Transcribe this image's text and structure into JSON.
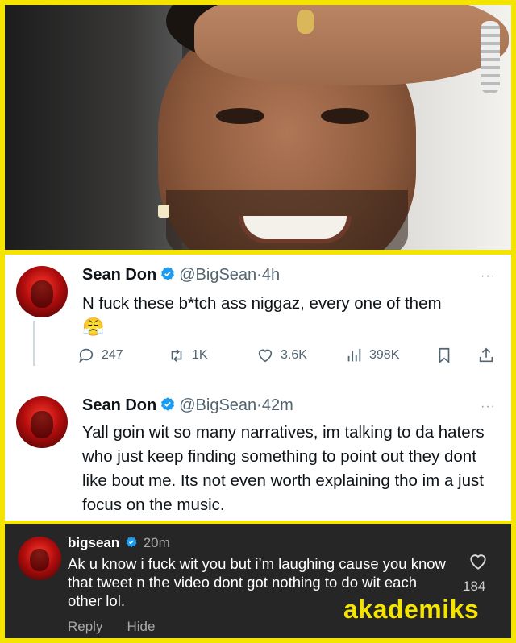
{
  "tweets": [
    {
      "name": "Sean Don",
      "handle": "@BigSean",
      "sep": "·",
      "time": "4h",
      "text": "N fuck these b*tch ass niggaz, every one of them",
      "emoji": "😤",
      "more": "···",
      "stats": {
        "replies": "247",
        "retweets": "1K",
        "likes": "3.6K",
        "views": "398K"
      }
    },
    {
      "name": "Sean Don",
      "handle": "@BigSean",
      "sep": "·",
      "time": "42m",
      "text": "Yall goin wit so many narratives, im talking to da haters who just keep finding something to point out they dont like bout me. Its not even worth explaining tho im a just focus on the music.",
      "more": "···"
    }
  ],
  "comment": {
    "username": "bigsean",
    "time": "20m",
    "text": "Ak u know i fuck wit you but i’m laughing cause you know that tweet n the video dont got nothing to do wit each other lol.",
    "likes": "184",
    "reply_label": "Reply",
    "hide_label": "Hide"
  },
  "watermark": "akademiks",
  "colors": {
    "frame": "#f4e400",
    "verified": "#1d9bf0",
    "comment_bg": "#262626",
    "brand": "#f4e400"
  }
}
